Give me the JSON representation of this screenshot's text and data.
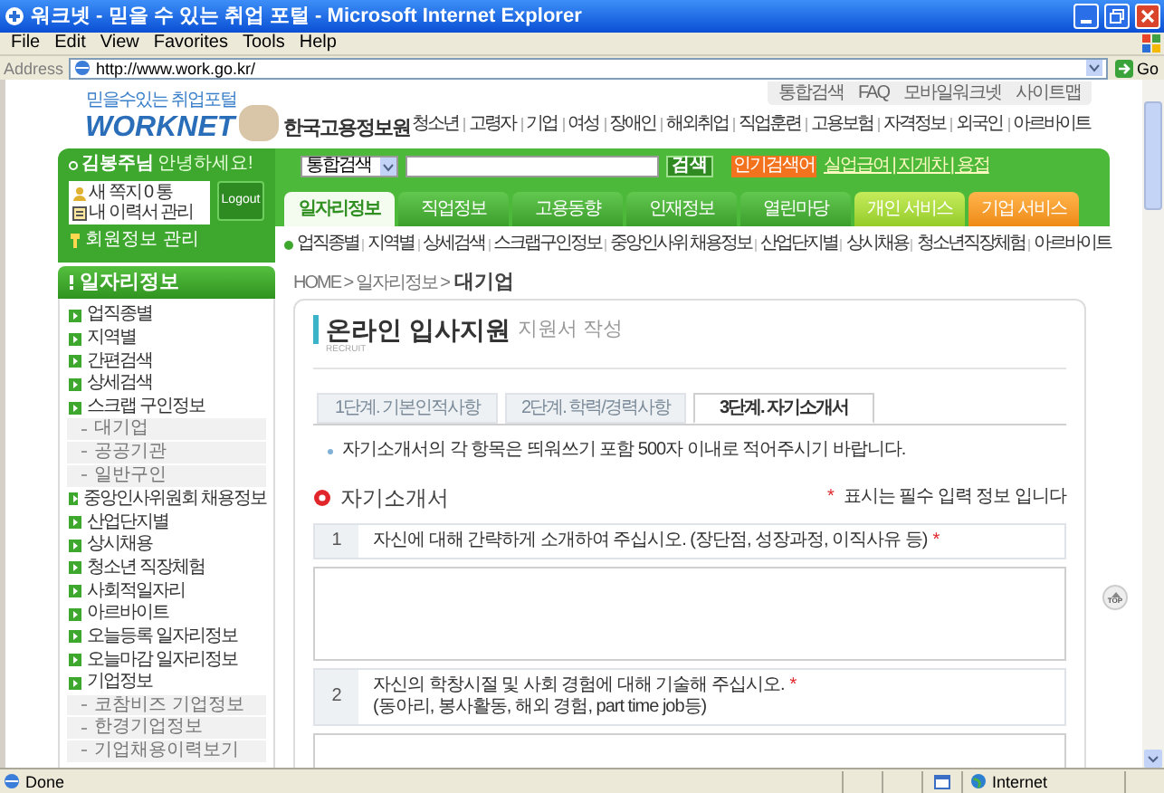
{
  "window": {
    "title": "워크넷 - 믿을 수 있는 취업 포털 - Microsoft Internet Explorer"
  },
  "menu": [
    "File",
    "Edit",
    "View",
    "Favorites",
    "Tools",
    "Help"
  ],
  "address_bar": {
    "label": "Address",
    "url": "http://www.work.go.kr/",
    "go": "Go"
  },
  "header": {
    "tagline": "믿을수있는 취업포털",
    "logo": "WORKNET",
    "org": "한국고용정보원"
  },
  "util_links": [
    "통합검색",
    "FAQ",
    "모바일워크넷",
    "사이트맵"
  ],
  "nav": [
    "청소년",
    "고령자",
    "기업",
    "여성",
    "장애인",
    "해외취업",
    "직업훈련",
    "고용보험",
    "자격정보",
    "외국인",
    "아르바이트"
  ],
  "user": {
    "name": "김봉주님",
    "greeting": "안녕하세요!",
    "messages": "새 쪽지 0 통",
    "resume": "내 이력서 관리",
    "logout": "Logout",
    "member": "회원정보 관리"
  },
  "search": {
    "scope": "통합검색",
    "button": "검색",
    "popular_label": "인기검색어",
    "popular": "실업급여 | 지게차 | 용접"
  },
  "tabs": [
    {
      "label": "일자리정보",
      "selected": true,
      "kind": "main"
    },
    {
      "label": "직업정보",
      "selected": false,
      "kind": "main"
    },
    {
      "label": "고용동향",
      "selected": false,
      "kind": "main"
    },
    {
      "label": "인재정보",
      "selected": false,
      "kind": "main"
    },
    {
      "label": "열린마당",
      "selected": false,
      "kind": "main"
    },
    {
      "label": "개인 서비스",
      "selected": false,
      "kind": "personal"
    },
    {
      "label": "기업 서비스",
      "selected": false,
      "kind": "corporate"
    }
  ],
  "subnav": [
    "업직종별",
    "지역별",
    "상세검색",
    "스크랩구인정보",
    "중앙인사위 채용정보",
    "산업단지별",
    "상시채용",
    "청소년직장체험",
    "아르바이트"
  ],
  "sidebar": {
    "title": "일자리정보",
    "items": [
      {
        "label": "업직종별",
        "kind": "main"
      },
      {
        "label": "지역별",
        "kind": "main"
      },
      {
        "label": "간편검색",
        "kind": "main"
      },
      {
        "label": "상세검색",
        "kind": "main"
      },
      {
        "label": "스크랩 구인정보",
        "kind": "main"
      },
      {
        "label": "대기업",
        "kind": "sub"
      },
      {
        "label": "공공기관",
        "kind": "sub"
      },
      {
        "label": "일반구인",
        "kind": "sub"
      },
      {
        "label": "중앙인사위원회 채용정보",
        "kind": "main"
      },
      {
        "label": "산업단지별",
        "kind": "main"
      },
      {
        "label": "상시채용",
        "kind": "main"
      },
      {
        "label": "청소년 직장체험",
        "kind": "main"
      },
      {
        "label": "사회적일자리",
        "kind": "main"
      },
      {
        "label": "아르바이트",
        "kind": "main"
      },
      {
        "label": "오늘등록 일자리정보",
        "kind": "main"
      },
      {
        "label": "오늘마감 일자리정보",
        "kind": "main"
      },
      {
        "label": "기업정보",
        "kind": "main"
      },
      {
        "label": "코참비즈 기업정보",
        "kind": "sub"
      },
      {
        "label": "한경기업정보",
        "kind": "sub"
      },
      {
        "label": "기업채용이력보기",
        "kind": "sub"
      }
    ]
  },
  "breadcrumb": {
    "path": "HOME > 일자리정보 >",
    "current": "대기업"
  },
  "page_title": {
    "title": "온라인 입사지원",
    "subtitle": "지원서 작성",
    "caption": "RECRUIT"
  },
  "steps": [
    {
      "label": "1단계. 기본인적사항",
      "selected": false
    },
    {
      "label": "2단계. 학력/경력사항",
      "selected": false
    },
    {
      "label": "3단계. 자기소개서",
      "selected": true
    }
  ],
  "notice": "자기소개서의 각 항목은 띄워쓰기 포함 500자 이내로 적어주시기 바랍니다.",
  "section": {
    "title": "자기소개서",
    "required_mark": "*",
    "required_note": "표시는 필수 입력 정보 입니다"
  },
  "questions": [
    {
      "number": "1",
      "text": "자신에 대해 간략하게 소개하여 주십시오. (장단점, 성장과정, 이직사유 등)",
      "required": true
    },
    {
      "number": "2",
      "text": "자신의 학창시절 및 사회 경험에 대해 기술해 주십시오.",
      "note": "(동아리, 봉사활동, 해외 경험, part time job등)",
      "required": true
    }
  ],
  "top_button": "TOP",
  "status_bar": {
    "text": "Done",
    "zone": "Internet"
  }
}
